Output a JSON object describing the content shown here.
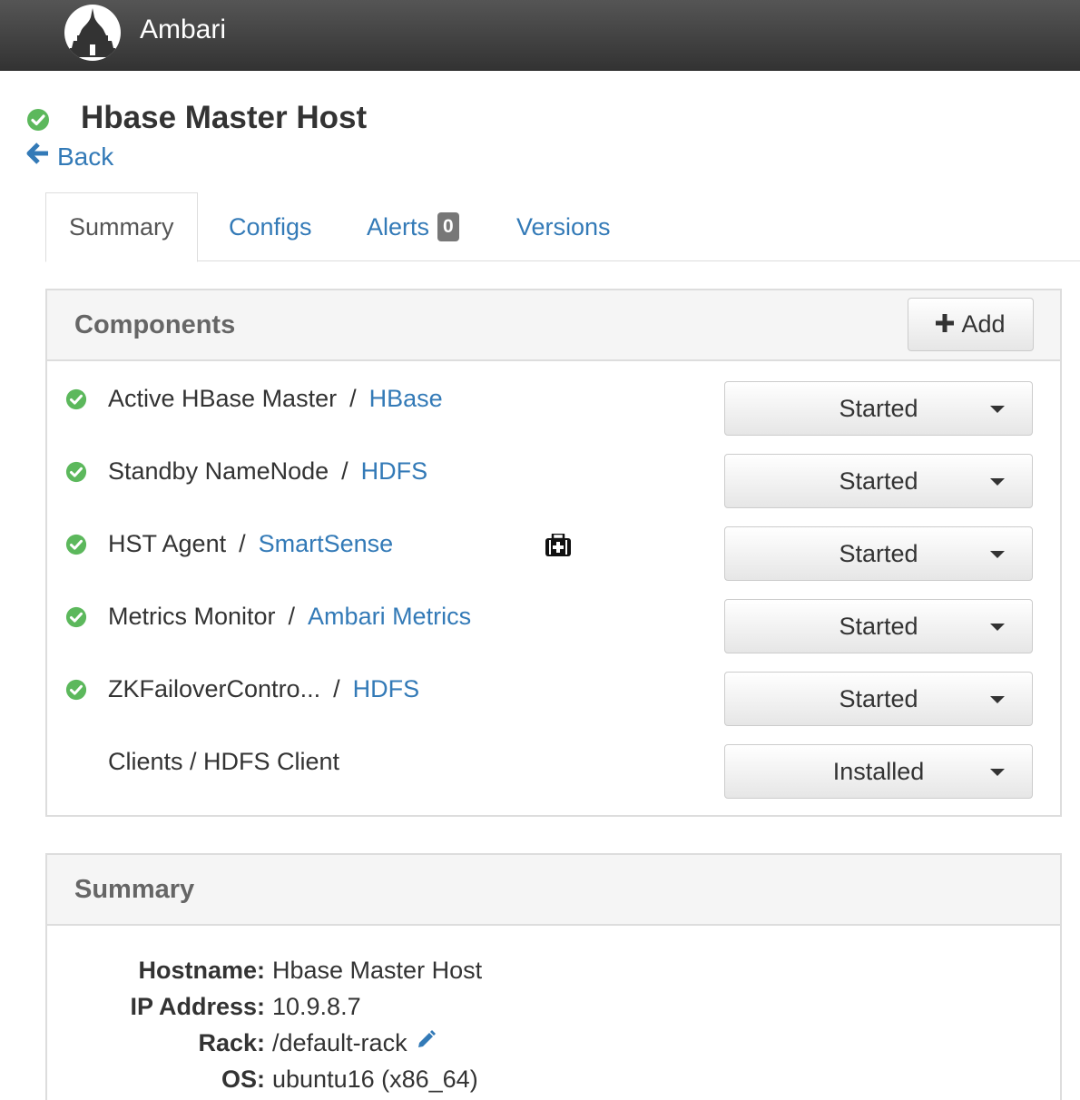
{
  "app": {
    "name": "Ambari"
  },
  "host": {
    "title": "Hbase Master Host",
    "status": "healthy"
  },
  "nav": {
    "back_label": "Back"
  },
  "tabs": [
    {
      "label": "Summary",
      "active": true
    },
    {
      "label": "Configs",
      "active": false
    },
    {
      "label": "Alerts",
      "active": false,
      "badge": "0"
    },
    {
      "label": "Versions",
      "active": false
    }
  ],
  "components_panel": {
    "title": "Components",
    "add_label": "Add",
    "rows": [
      {
        "name": "Active HBase Master",
        "separator": "/",
        "service": "HBase",
        "state": "Started",
        "status": "healthy"
      },
      {
        "name": "Standby NameNode",
        "separator": "/",
        "service": "HDFS",
        "state": "Started",
        "status": "healthy"
      },
      {
        "name": "HST Agent",
        "separator": "/",
        "service": "SmartSense",
        "state": "Started",
        "status": "healthy",
        "extra_icon": "medkit-icon"
      },
      {
        "name": "Metrics Monitor",
        "separator": "/",
        "service": "Ambari Metrics",
        "state": "Started",
        "status": "healthy"
      },
      {
        "name": "ZKFailoverContro...",
        "separator": "/",
        "service": "HDFS",
        "state": "Started",
        "status": "healthy"
      },
      {
        "name": "Clients / HDFS Client",
        "state": "Installed"
      }
    ]
  },
  "summary_panel": {
    "title": "Summary",
    "fields": [
      {
        "label": "Hostname:",
        "value": "Hbase Master Host"
      },
      {
        "label": "IP Address:",
        "value": "10.9.8.7"
      },
      {
        "label": "Rack:",
        "value": "/default-rack",
        "editable": true
      },
      {
        "label": "OS:",
        "value": "ubuntu16 (x86_64)"
      }
    ]
  },
  "colors": {
    "accent": "#337ab7",
    "success": "#5cb85c",
    "topbar": "#444444",
    "badge": "#777777"
  }
}
